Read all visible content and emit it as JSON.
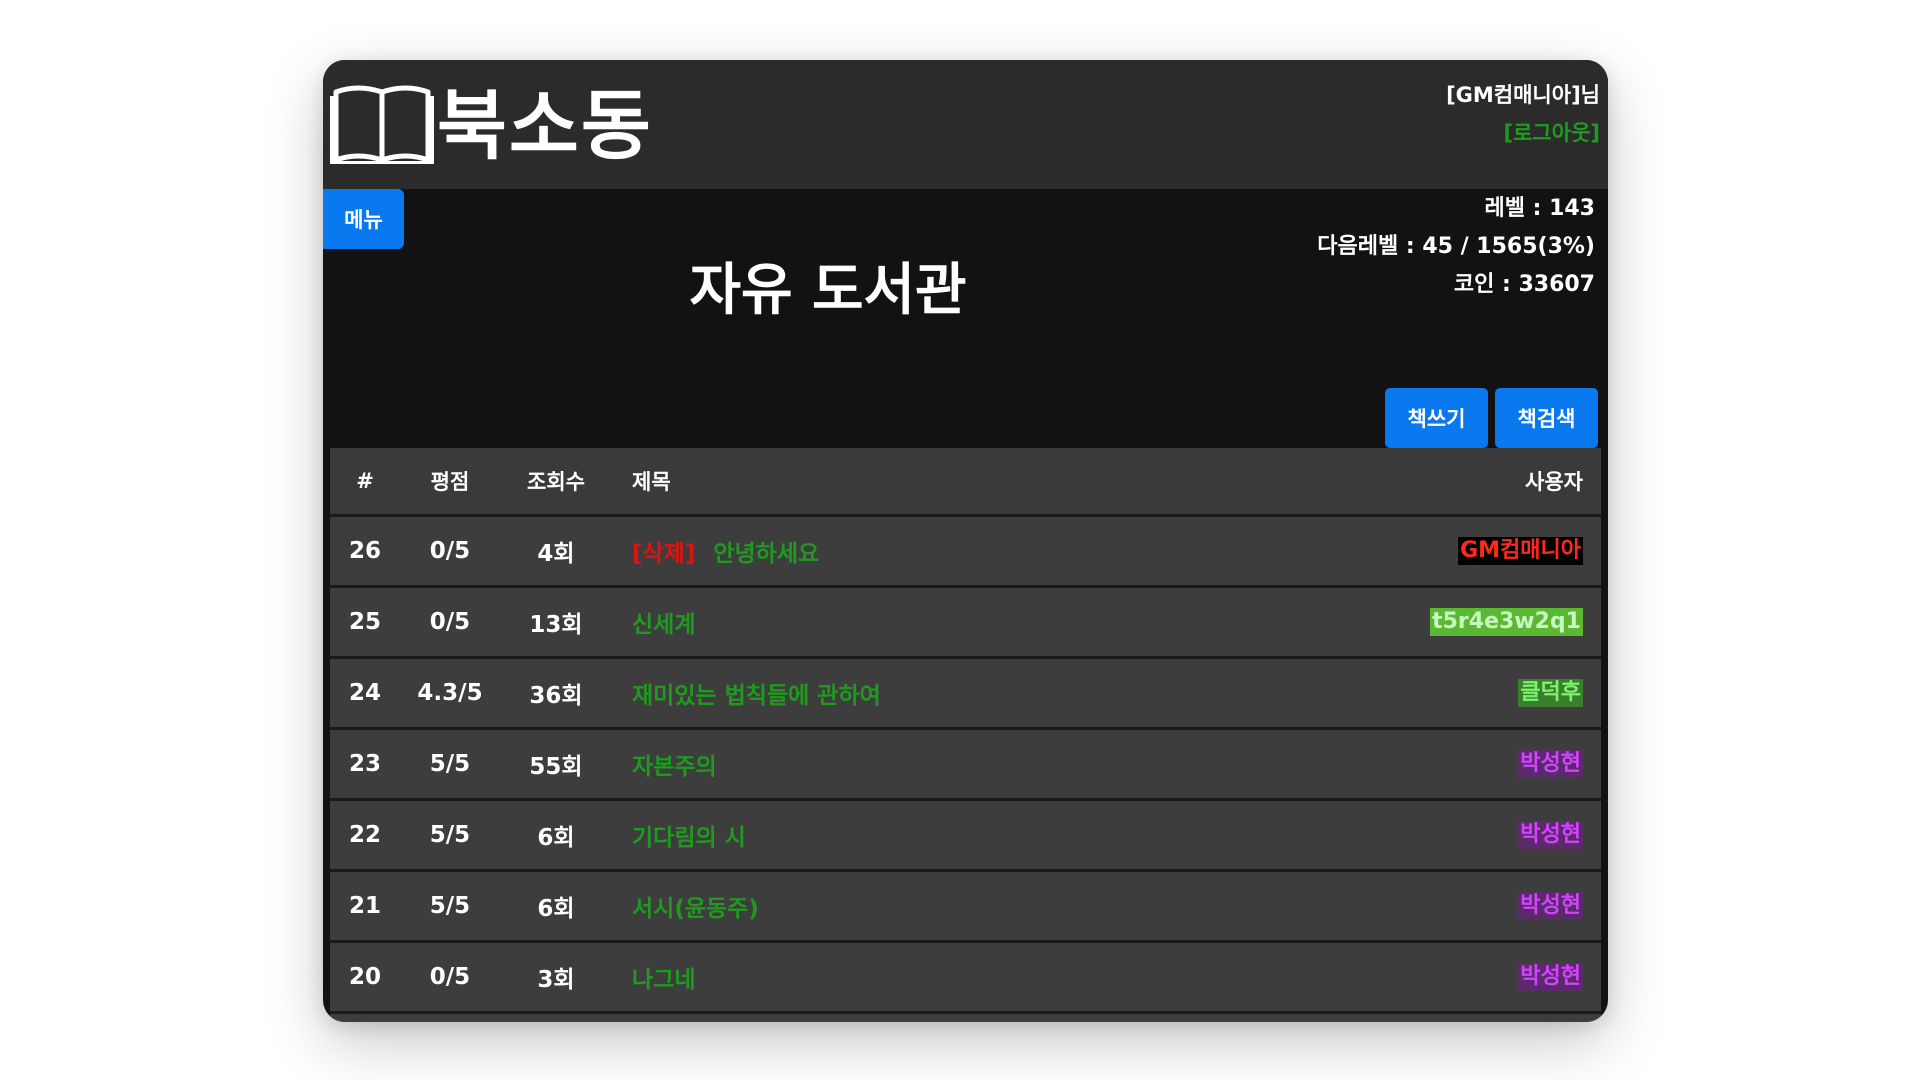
{
  "header": {
    "brand": "북소동",
    "username": "[GM컴매니아]님",
    "logout": "[로그아웃]"
  },
  "menu_label": "메뉴",
  "stats": {
    "level": "레벨 : 143",
    "next_level": "다음레벨 : 45 / 1565(3%)",
    "coins": "코인 : 33607"
  },
  "page_title": "자유 도서관",
  "actions": {
    "write": "책쓰기",
    "search": "책검색"
  },
  "table": {
    "columns": [
      "#",
      "평점",
      "조회수",
      "제목",
      "사용자"
    ],
    "rows": [
      {
        "num": "26",
        "rating": "0/5",
        "views": "4회",
        "tag": "[삭제]",
        "title": "안녕하세요",
        "user": "GM컴매니아",
        "user_color": "#ff2a1a"
      },
      {
        "num": "25",
        "rating": "0/5",
        "views": "13회",
        "title": "신세계",
        "user": "t5r4e3w2q1",
        "user_color": "#c8f7c0"
      },
      {
        "num": "24",
        "rating": "4.3/5",
        "views": "36회",
        "title": "재미있는 법칙들에 관하여",
        "user": "클덕후",
        "user_color": "#7cf36b"
      },
      {
        "num": "23",
        "rating": "5/5",
        "views": "55회",
        "title": "자본주의",
        "user": "박성현",
        "user_color": "#d342ff"
      },
      {
        "num": "22",
        "rating": "5/5",
        "views": "6회",
        "title": "기다림의 시",
        "user": "박성현",
        "user_color": "#d342ff"
      },
      {
        "num": "21",
        "rating": "5/5",
        "views": "6회",
        "title": "서시(윤동주)",
        "user": "박성현",
        "user_color": "#d342ff"
      },
      {
        "num": "20",
        "rating": "0/5",
        "views": "3회",
        "title": "나그네",
        "user": "박성현",
        "user_color": "#d342ff"
      }
    ]
  },
  "colors": {
    "accent": "#0a79f0",
    "title_green": "#1f9a1f",
    "delete_red": "#e01212"
  },
  "icons": {
    "logo": "open-book-icon"
  }
}
